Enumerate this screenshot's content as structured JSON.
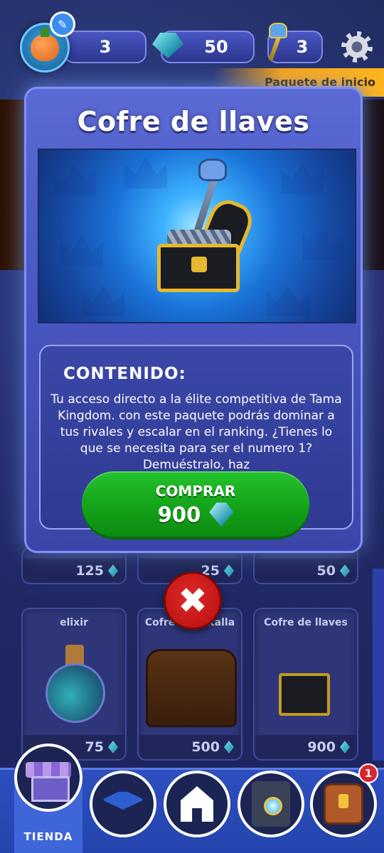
{
  "top_bar": {
    "level": "3",
    "gems": "50",
    "keys": "3"
  },
  "background": {
    "banner_tab_label": "Paquete de inicio",
    "cards_row1_prices": [
      "125",
      "25",
      "50"
    ],
    "cards_row2": [
      {
        "title": "elixir",
        "price": "75"
      },
      {
        "title": "Cofre de batalla",
        "price": "500"
      },
      {
        "title": "Cofre de llaves",
        "price": "900"
      }
    ]
  },
  "modal": {
    "title": "Cofre de llaves",
    "content_heading": "CONTENIDO:",
    "content_text": "Tu acceso directo a la élite competitiva de Tama Kingdom. con este paquete podrás dominar a tus rivales y escalar en el ranking. ¿Tienes lo que se necesita para ser el numero 1? Demuéstralo, haz",
    "buy_label": "COMPRAR",
    "buy_price": "900"
  },
  "close_label": "✖",
  "bottom_nav": {
    "active_label": "TIENDA",
    "notification_count": "1",
    "icons": [
      "store-icon",
      "graduation-cap-icon",
      "home-icon",
      "tower-icon",
      "backpack-icon"
    ]
  },
  "colors": {
    "accent_blue": "#4a56c2",
    "buy_green": "#13a018",
    "close_red": "#c41414",
    "nav_blue": "#2d4fbf"
  }
}
